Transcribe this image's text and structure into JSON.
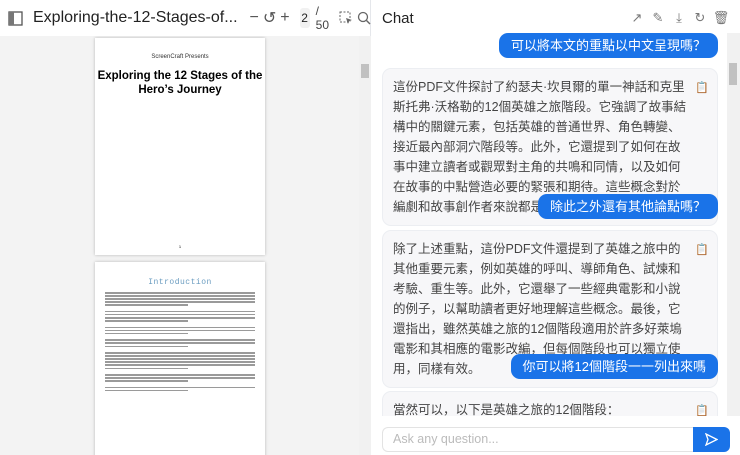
{
  "pdf": {
    "title": "Exploring-the-12-Stages-of...",
    "page": "2",
    "total": "/ 50",
    "page1": {
      "presents": "ScreenCraft Presents",
      "heading": "Exploring the 12 Stages of the Hero’s Journey",
      "number": "1"
    },
    "page2": {
      "heading": "Introduction"
    }
  },
  "chat": {
    "title": "Chat",
    "input_placeholder": "Ask any question...",
    "messages": [
      {
        "role": "user",
        "text": "可以將本文的重點以中文呈現嗎？"
      },
      {
        "role": "assistant",
        "text": "這份PDF文件探討了約瑟夫·坎貝爾的單一神話和克里斯托弗·沃格勒的12個英雄之旅階段。它強調了故事結構中的關鍵元素，包括英雄的普通世界、角色轉變、接近最內部洞穴階段等。此外，它還提到了如何在故事中建立讀者或觀眾對主角的共鳴和同情，以及如何在故事的中點營造必要的緊張和期待。這些概念對於編劇和故事創作者來說都是非常寶貴的。"
      },
      {
        "role": "user",
        "text": "除此之外還有其他論點嗎？"
      },
      {
        "role": "assistant",
        "text": "除了上述重點，這份PDF文件還提到了英雄之旅中的其他重要元素，例如英雄的呼叫、導師角色、試煉和考驗、重生等。此外，它還舉了一些經典電影和小說的例子，以幫助讀者更好地理解這些概念。最後，它還指出，雖然英雄之旅的12個階段適用於許多好萊塢電影和其相應的電影改編，但每個階段也可以獨立使用，同樣有效。"
      },
      {
        "role": "user",
        "text": "你可以將12個階段一一列出來嗎"
      },
      {
        "role": "assistant",
        "text": "當然可以，以下是英雄之旅的12個階段："
      }
    ]
  },
  "colors": {
    "accent": "#1a73e8"
  }
}
